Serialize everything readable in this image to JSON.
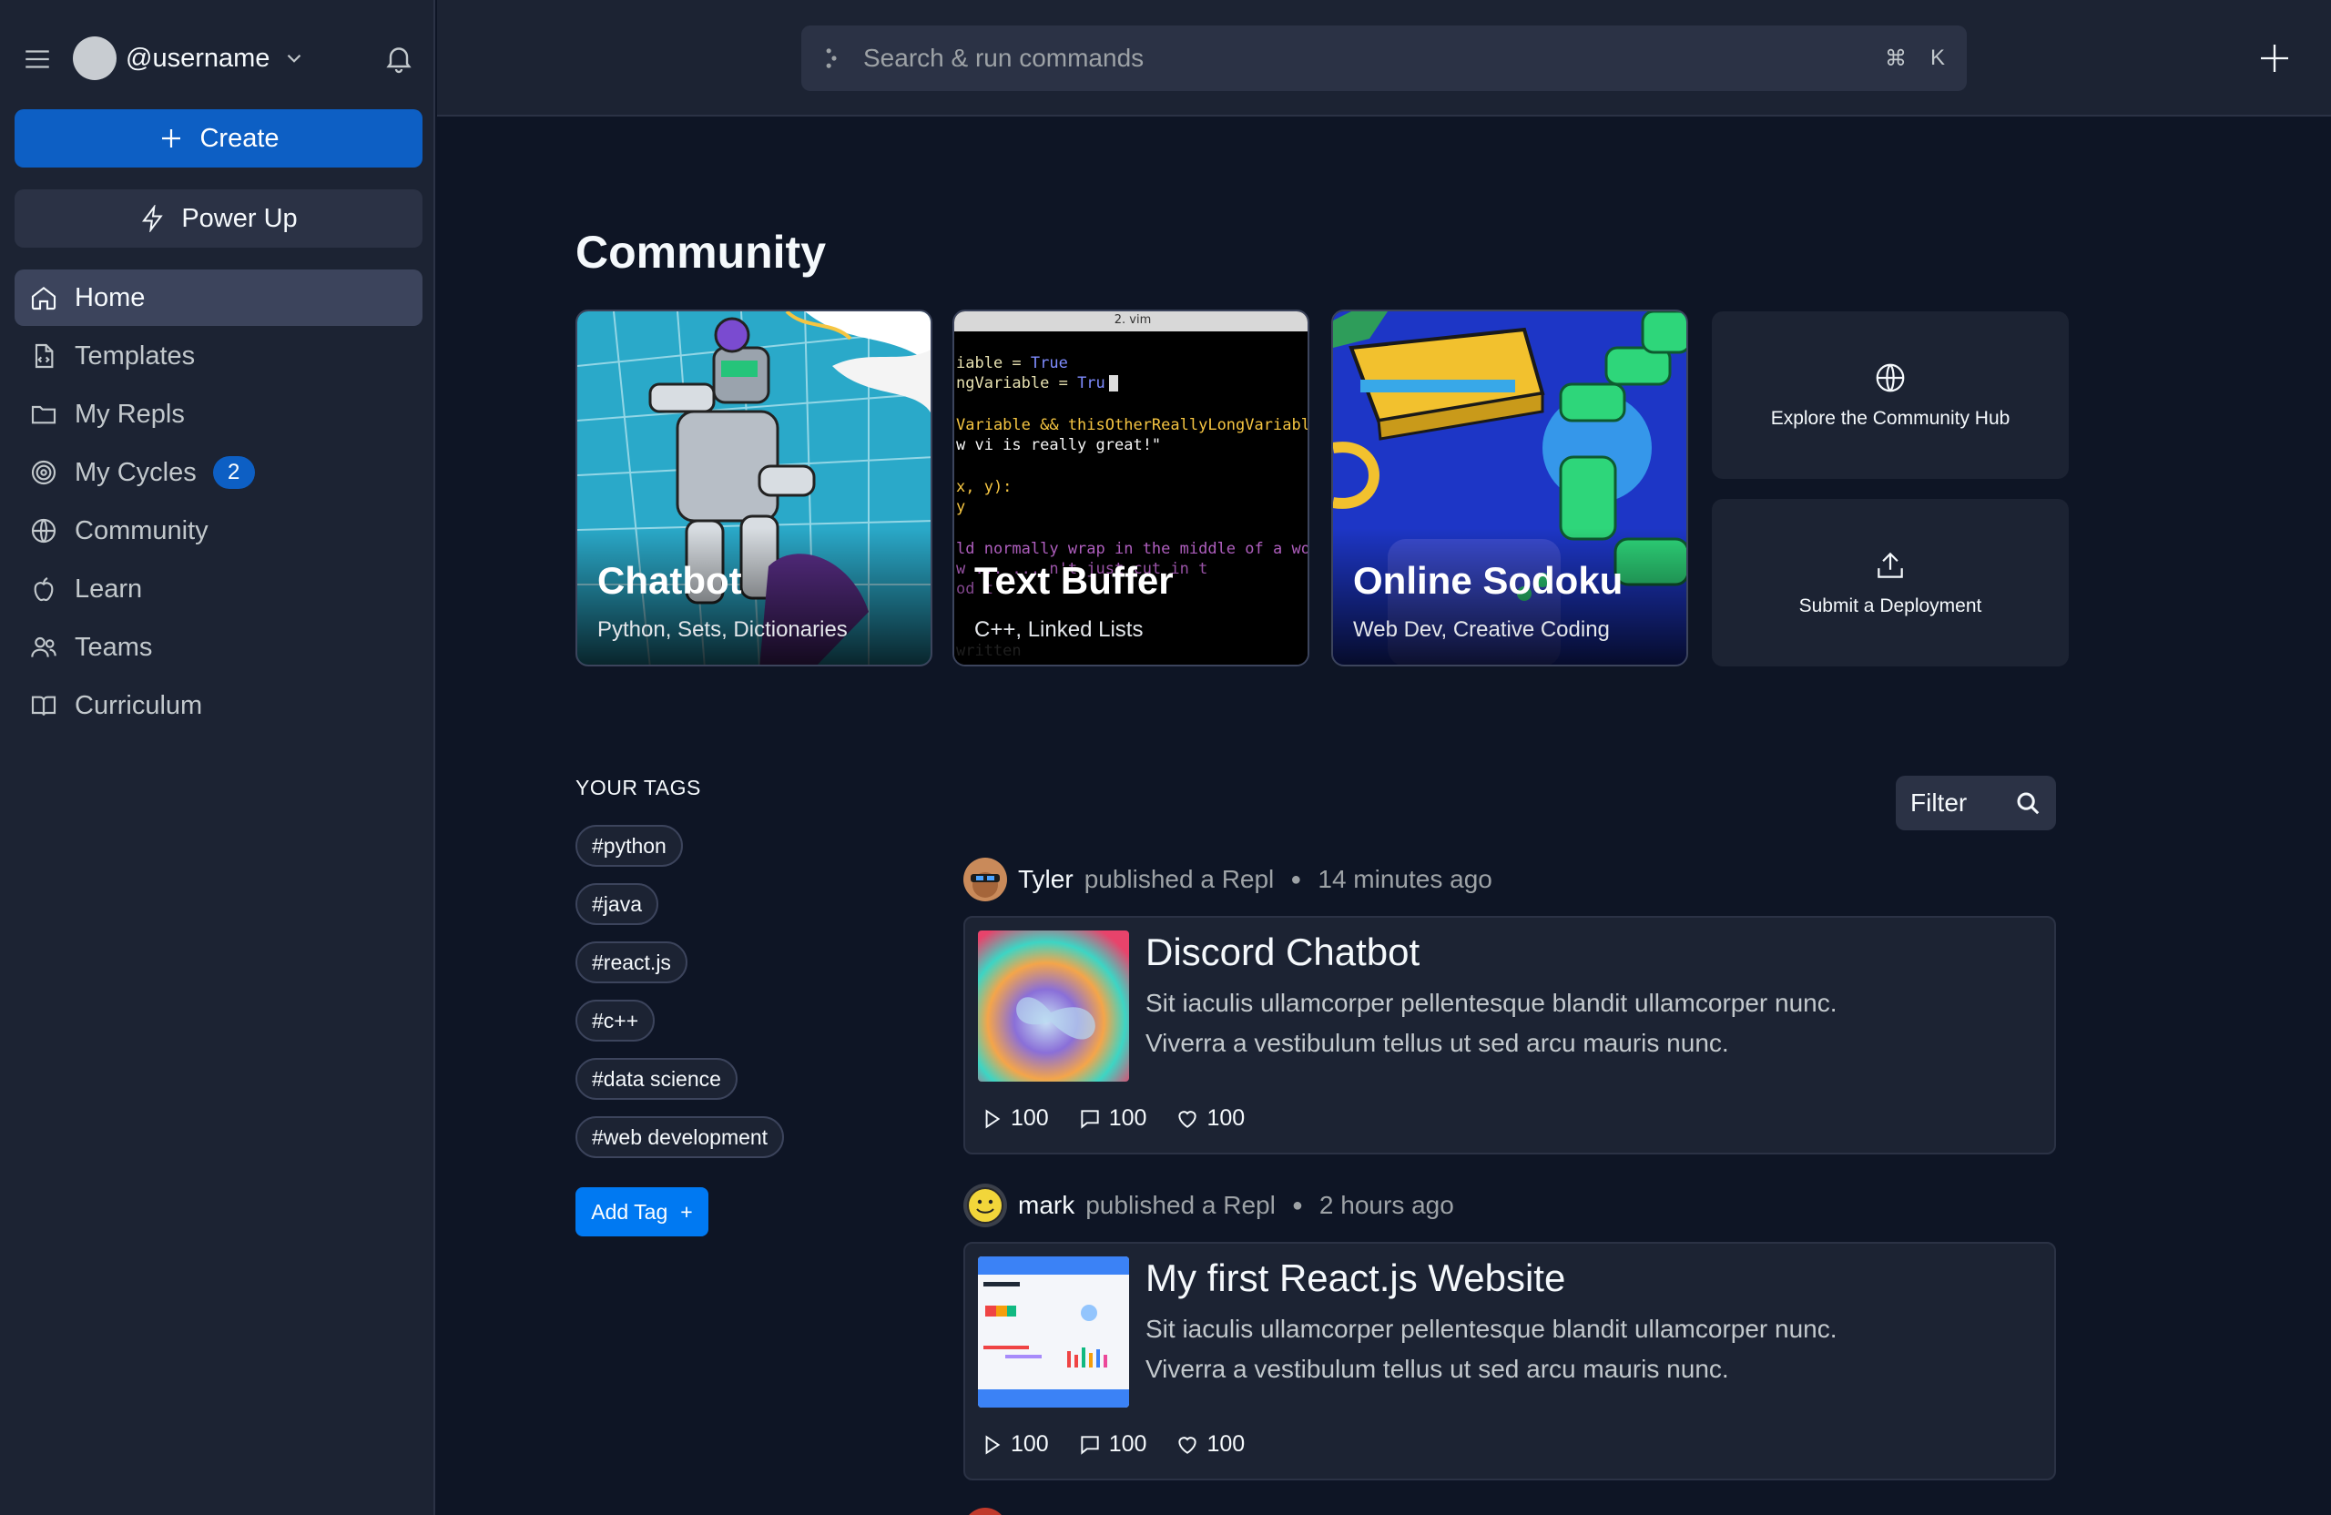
{
  "sidebar": {
    "username": "@username",
    "create_label": "Create",
    "powerup_label": "Power Up",
    "nav": [
      {
        "label": "Home",
        "icon": "home-icon",
        "active": true
      },
      {
        "label": "Templates",
        "icon": "template-icon"
      },
      {
        "label": "My Repls",
        "icon": "folder-icon"
      },
      {
        "label": "My Cycles",
        "icon": "cycles-icon",
        "badge": "2"
      },
      {
        "label": "Community",
        "icon": "globe-icon"
      },
      {
        "label": "Learn",
        "icon": "apple-icon"
      },
      {
        "label": "Teams",
        "icon": "teams-icon"
      },
      {
        "label": "Curriculum",
        "icon": "book-icon"
      }
    ]
  },
  "topbar": {
    "search_placeholder": "Search & run commands",
    "shortcut_cmd": "⌘",
    "shortcut_key": "K"
  },
  "community": {
    "title": "Community",
    "cards": [
      {
        "title": "Chatbot",
        "subtitle": "Python, Sets, Dictionaries"
      },
      {
        "title": "Text Buffer",
        "subtitle": "C++, Linked Lists",
        "window_title": "2. vim"
      },
      {
        "title": "Online Sodoku",
        "subtitle": "Web Dev, Creative Coding"
      }
    ],
    "explore_label": "Explore the Community Hub",
    "submit_label": "Submit a Deployment"
  },
  "tags": {
    "heading": "YOUR TAGS",
    "items": [
      "#python",
      "#java",
      "#react.js",
      "#c++",
      "#data science",
      "#web development"
    ],
    "add_label": "Add Tag",
    "add_plus": "+"
  },
  "feed": {
    "filter_label": "Filter",
    "posts": [
      {
        "user": "Tyler",
        "action": "published a Repl",
        "time": "14 minutes ago",
        "title": "Discord Chatbot",
        "description": "Sit iaculis ullamcorper pellentesque blandit ullamcorper nunc. Viverra a vestibulum tellus ut sed arcu mauris nunc.",
        "runs": "100",
        "comments": "100",
        "likes": "100"
      },
      {
        "user": "mark",
        "action": "published a Repl",
        "time": "2 hours ago",
        "title": "My first React.js Website",
        "description": "Sit iaculis ullamcorper pellentesque blandit ullamcorper nunc. Viverra a vestibulum tellus ut sed arcu mauris nunc.",
        "runs": "100",
        "comments": "100",
        "likes": "100"
      }
    ]
  },
  "colors": {
    "background": "#0e1525",
    "surface": "#1c2333",
    "primary": "#0d5fc4",
    "accent": "#0079f2"
  }
}
